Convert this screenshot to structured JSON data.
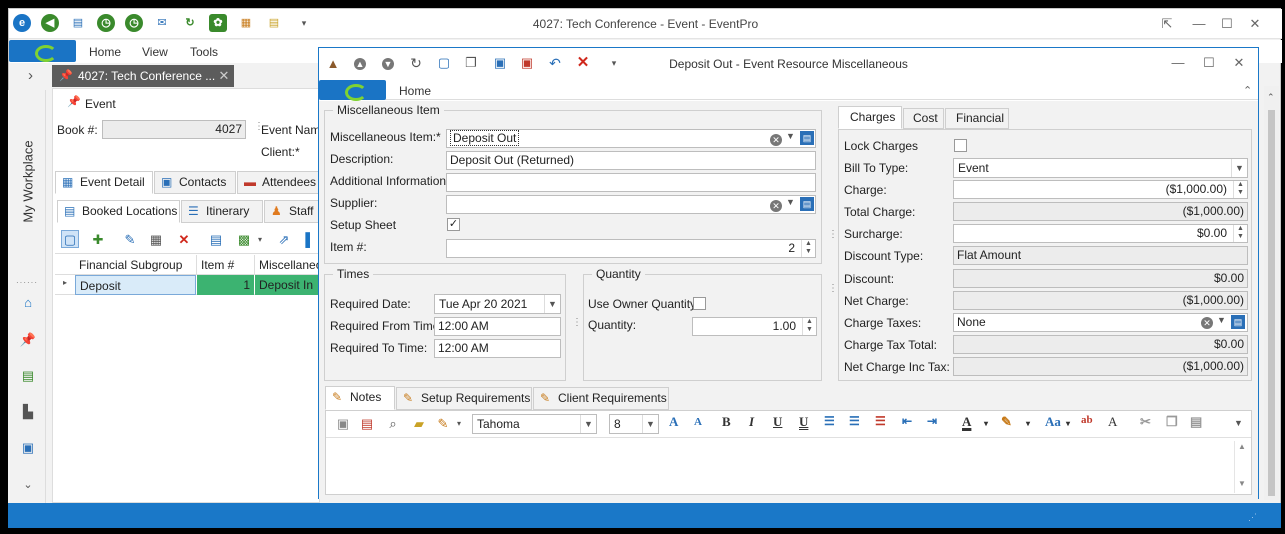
{
  "app": {
    "title": "4027: Tech Conference - Event - EventPro"
  },
  "menu": [
    "Home",
    "View",
    "Tools"
  ],
  "sidebar": {
    "label": "My Workplace"
  },
  "doc_tab": {
    "label": "4027: Tech Conference ..."
  },
  "event": {
    "section_label": "Event",
    "book_label": "Book #:",
    "book_value": "4027",
    "event_name_label": "Event Name",
    "client_label": "Client:*",
    "tabs1": [
      "Event Detail",
      "Contacts",
      "Attendees"
    ],
    "tabs2": [
      "Booked Locations",
      "Itinerary",
      "Staff"
    ],
    "grid": {
      "columns": [
        "Financial Subgroup",
        "Item #",
        "Miscellaneous"
      ],
      "rows": [
        {
          "subgroup": "Deposit",
          "item": "1",
          "misc": "Deposit In"
        }
      ]
    }
  },
  "dialog": {
    "title": "Deposit Out - Event Resource Miscellaneous",
    "ribbon_tab": "Home",
    "misc": {
      "group_title": "Miscellaneous Item",
      "item_label": "Miscellaneous Item:*",
      "item_value": "Deposit Out",
      "desc_label": "Description:",
      "desc_value": "Deposit Out (Returned)",
      "addinfo_label": "Additional Information:",
      "addinfo_value": "",
      "supplier_label": "Supplier:",
      "supplier_value": "",
      "setup_label": "Setup Sheet",
      "setup_checked": true,
      "itemno_label": "Item #:",
      "itemno_value": "2"
    },
    "times": {
      "group_title": "Times",
      "date_label": "Required Date:",
      "date_value": "Tue Apr 20 2021",
      "from_label": "Required From Time:",
      "from_value": "12:00 AM",
      "to_label": "Required To Time:",
      "to_value": "12:00 AM"
    },
    "quantity": {
      "group_title": "Quantity",
      "owner_label": "Use Owner Quantity",
      "owner_checked": false,
      "qty_label": "Quantity:",
      "qty_value": "1.00"
    },
    "right_tabs": [
      "Charges",
      "Cost",
      "Financial"
    ],
    "charges": {
      "lock_label": "Lock Charges",
      "lock_checked": false,
      "billto_label": "Bill To Type:",
      "billto_value": "Event",
      "charge_label": "Charge:",
      "charge_value": "($1,000.00)",
      "total_label": "Total Charge:",
      "total_value": "($1,000.00)",
      "surcharge_label": "Surcharge:",
      "surcharge_value": "$0.00",
      "disctype_label": "Discount Type:",
      "disctype_value": "Flat Amount",
      "disc_label": "Discount:",
      "disc_value": "$0.00",
      "net_label": "Net Charge:",
      "net_value": "($1,000.00)",
      "taxes_label": "Charge Taxes:",
      "taxes_value": "None",
      "taxtotal_label": "Charge Tax Total:",
      "taxtotal_value": "$0.00",
      "netinc_label": "Net Charge Inc Tax:",
      "netinc_value": "($1,000.00)"
    },
    "bottom_tabs": [
      "Notes",
      "Setup Requirements",
      "Client Requirements"
    ],
    "editor": {
      "font": "Tahoma",
      "size": "8"
    }
  },
  "colors": {
    "accent": "#1a78c8",
    "selected_cell": "#3cb371"
  }
}
